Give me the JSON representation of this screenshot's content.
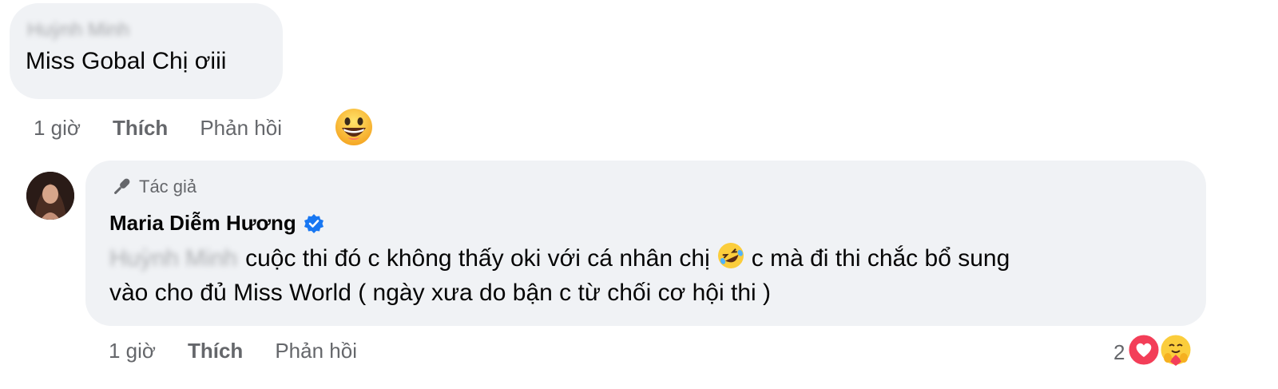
{
  "comment1": {
    "author_blurred": "Huỳnh Minh",
    "text": "Miss Gobal Chị ơiii",
    "time": "1 giờ",
    "like_label": "Thích",
    "reply_label": "Phản hồi",
    "reaction_icon": "grinning-face-icon"
  },
  "reply": {
    "badge_label": "Tác giả",
    "badge_icon": "microphone-icon",
    "author_name": "Maria Diễm Hương",
    "verified_icon": "verified-badge-icon",
    "mention_blurred": "Huỳnh Minh",
    "text_part1": "cuộc thi đó c không thấy oki với cá nhân chị",
    "inline_emoji": "rolling-laughing-icon",
    "text_part2": "c mà đi thi chắc bổ sung",
    "text_line2": "vào cho đủ Miss World ( ngày xưa do bận c từ chối cơ hội thi )",
    "time": "1 giờ",
    "like_label": "Thích",
    "reply_label": "Phản hồi",
    "reaction_count": "2",
    "reaction_icons": [
      "heart-icon",
      "care-hug-icon"
    ]
  },
  "colors": {
    "bubble": "#f0f2f5",
    "text": "#050505",
    "secondary": "#65676b",
    "verified": "#1877f2",
    "heart": "#f33e58",
    "emoji_yellow": "#fbcd3c"
  }
}
